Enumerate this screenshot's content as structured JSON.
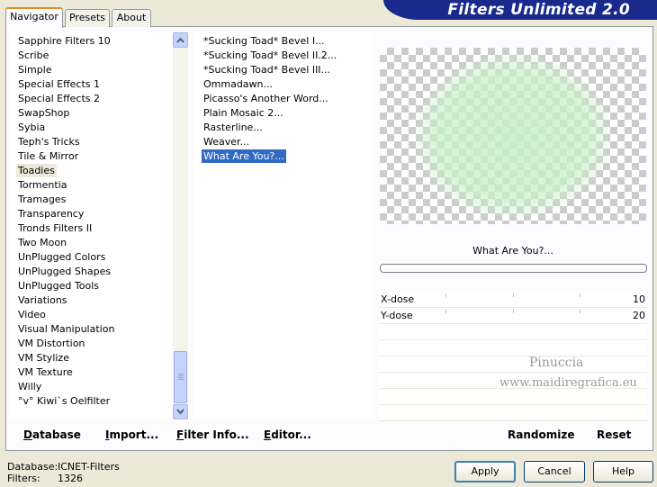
{
  "banner": {
    "title": "Filters Unlimited 2.0"
  },
  "tabs": [
    {
      "label": "Navigator"
    },
    {
      "label": "Presets"
    },
    {
      "label": "About"
    }
  ],
  "categories": [
    "Sapphire Filters 10",
    "Scribe",
    "Simple",
    "Special Effects 1",
    "Special Effects 2",
    "SwapShop",
    "Sybia",
    "Teph's Tricks",
    "Tile & Mirror",
    "Toadies",
    "Tormentia",
    "Tramages",
    "Transparency",
    "Tronds Filters II",
    "Two Moon",
    "UnPlugged Colors",
    "UnPlugged Shapes",
    "UnPlugged Tools",
    "Variations",
    "Video",
    "Visual Manipulation",
    "VM Distortion",
    "VM Stylize",
    "VM Texture",
    "Willy",
    "°v° Kiwi`s Oelfilter"
  ],
  "selected_category": "Toadies",
  "filters": [
    "*Sucking Toad*  Bevel I...",
    "*Sucking Toad*  Bevel II.2...",
    "*Sucking Toad*  Bevel III...",
    "Ommadawn...",
    "Picasso's Another Word...",
    "Plain Mosaic 2...",
    "Rasterline...",
    "Weaver...",
    "What Are You?..."
  ],
  "selected_filter": "What Are You?...",
  "preview": {
    "filter_name": "What Are You?..."
  },
  "params": [
    {
      "label": "X-dose",
      "value": "10"
    },
    {
      "label": "Y-dose",
      "value": "20"
    }
  ],
  "watermark": {
    "line1": "Pinuccia",
    "line2": "www.maidiregrafica.eu"
  },
  "links": {
    "database": {
      "text": "Database",
      "underline": "D"
    },
    "import": {
      "text": "Import...",
      "underline": "I"
    },
    "filter_info": {
      "text": "Filter Info...",
      "underline": "F"
    },
    "editor": {
      "text": "Editor...",
      "underline": "E"
    },
    "randomize": "Randomize",
    "reset": "Reset"
  },
  "status": {
    "database_label": "Database:",
    "database_value": "ICNET-Filters",
    "filters_label": "Filters:",
    "filters_value": "1326"
  },
  "buttons": {
    "apply": "Apply",
    "cancel": "Cancel",
    "help": "Help"
  },
  "colors": {
    "banner": "#1a2a8c",
    "selection": "#316ac5",
    "preview_glow": "#c8f0c8"
  }
}
